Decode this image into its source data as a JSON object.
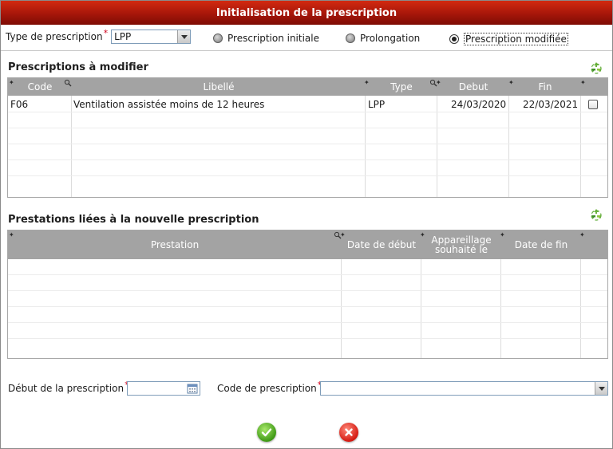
{
  "dialog": {
    "title": "Initialisation de la prescription"
  },
  "type_row": {
    "label": "Type de prescription",
    "required_mark": "*",
    "selected": "LPP",
    "radios": [
      {
        "label": "Prescription initiale",
        "checked": false
      },
      {
        "label": "Prolongation",
        "checked": false
      },
      {
        "label": "Prescription modifiée",
        "checked": true
      }
    ]
  },
  "prescriptions": {
    "title": "Prescriptions à modifier",
    "columns": [
      "Code",
      "Libellé",
      "Type",
      "Debut",
      "Fin"
    ],
    "rows": [
      {
        "code": "F06",
        "libelle": "Ventilation assistée moins de 12 heures",
        "type": "LPP",
        "debut": "24/03/2020",
        "fin": "22/03/2021",
        "checked": false
      }
    ]
  },
  "prestations": {
    "title": "Prestations liées à la nouvelle prescription",
    "columns": [
      "Prestation",
      "Date de début",
      "Appareillage souhaité le",
      "Date de fin"
    ]
  },
  "bottom": {
    "debut_label": "Début de la prescription",
    "debut_required": "*",
    "debut_value": "",
    "code_label": "Code de prescription",
    "code_required": "*",
    "code_value": ""
  },
  "icons": {
    "ok": "check-icon",
    "cancel": "close-icon",
    "refresh": "recycle-icon",
    "calendar": "calendar-icon"
  },
  "colors": {
    "title_bar": "#a6160a",
    "grid_header": "#a3a3a3",
    "required": "#d0021b"
  }
}
